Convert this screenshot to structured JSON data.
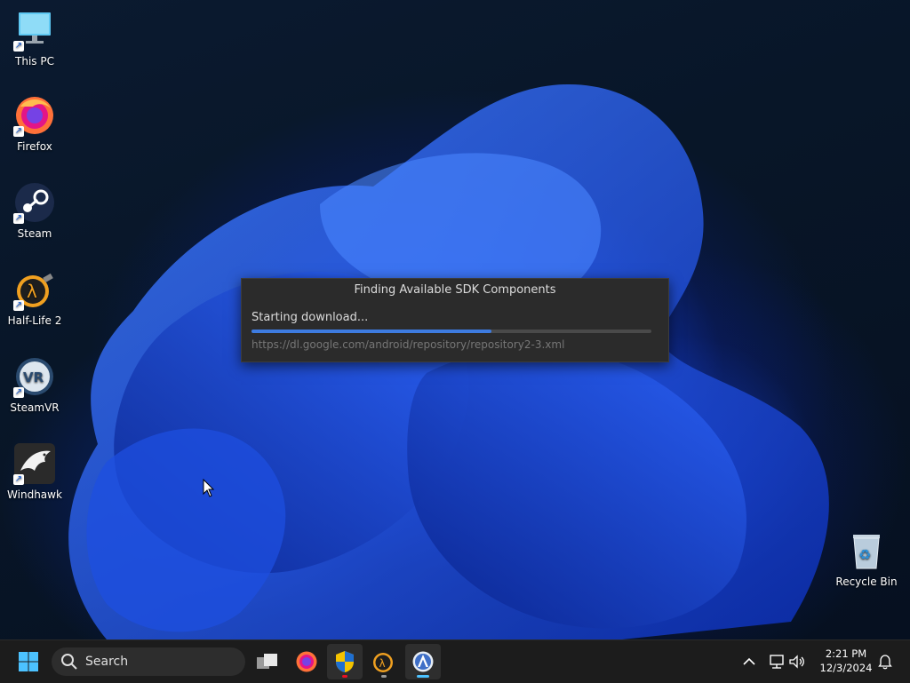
{
  "desktop": {
    "icons": [
      {
        "label": "This PC",
        "icon": "computer-icon"
      },
      {
        "label": "Firefox",
        "icon": "firefox-icon"
      },
      {
        "label": "Steam",
        "icon": "steam-icon"
      },
      {
        "label": "Half-Life 2",
        "icon": "half-life-icon"
      },
      {
        "label": "SteamVR",
        "icon": "steamvr-icon"
      },
      {
        "label": "Windhawk",
        "icon": "windhawk-icon"
      },
      {
        "label": "Recycle Bin",
        "icon": "recycle-bin-icon"
      }
    ]
  },
  "dialog": {
    "title": "Finding Available SDK Components",
    "status": "Starting download...",
    "progress": 0.6,
    "url": "https://dl.google.com/android/repository/repository2-3.xml"
  },
  "taskbar": {
    "search_label": "Search",
    "apps": [
      {
        "name": "task-view",
        "icon": "task-view-icon"
      },
      {
        "name": "firefox",
        "icon": "firefox-icon"
      },
      {
        "name": "security-shield",
        "icon": "shield-icon"
      },
      {
        "name": "half-life-2",
        "icon": "half-life-icon"
      },
      {
        "name": "android-studio",
        "icon": "android-studio-icon"
      }
    ],
    "tray": {
      "time": "2:21 PM",
      "date": "12/3/2024"
    }
  },
  "colors": {
    "accent": "#4cc2ff",
    "progress": "#3d7be0",
    "dialog_bg": "#2b2b2b",
    "taskbar_bg": "#1c1c1c"
  }
}
